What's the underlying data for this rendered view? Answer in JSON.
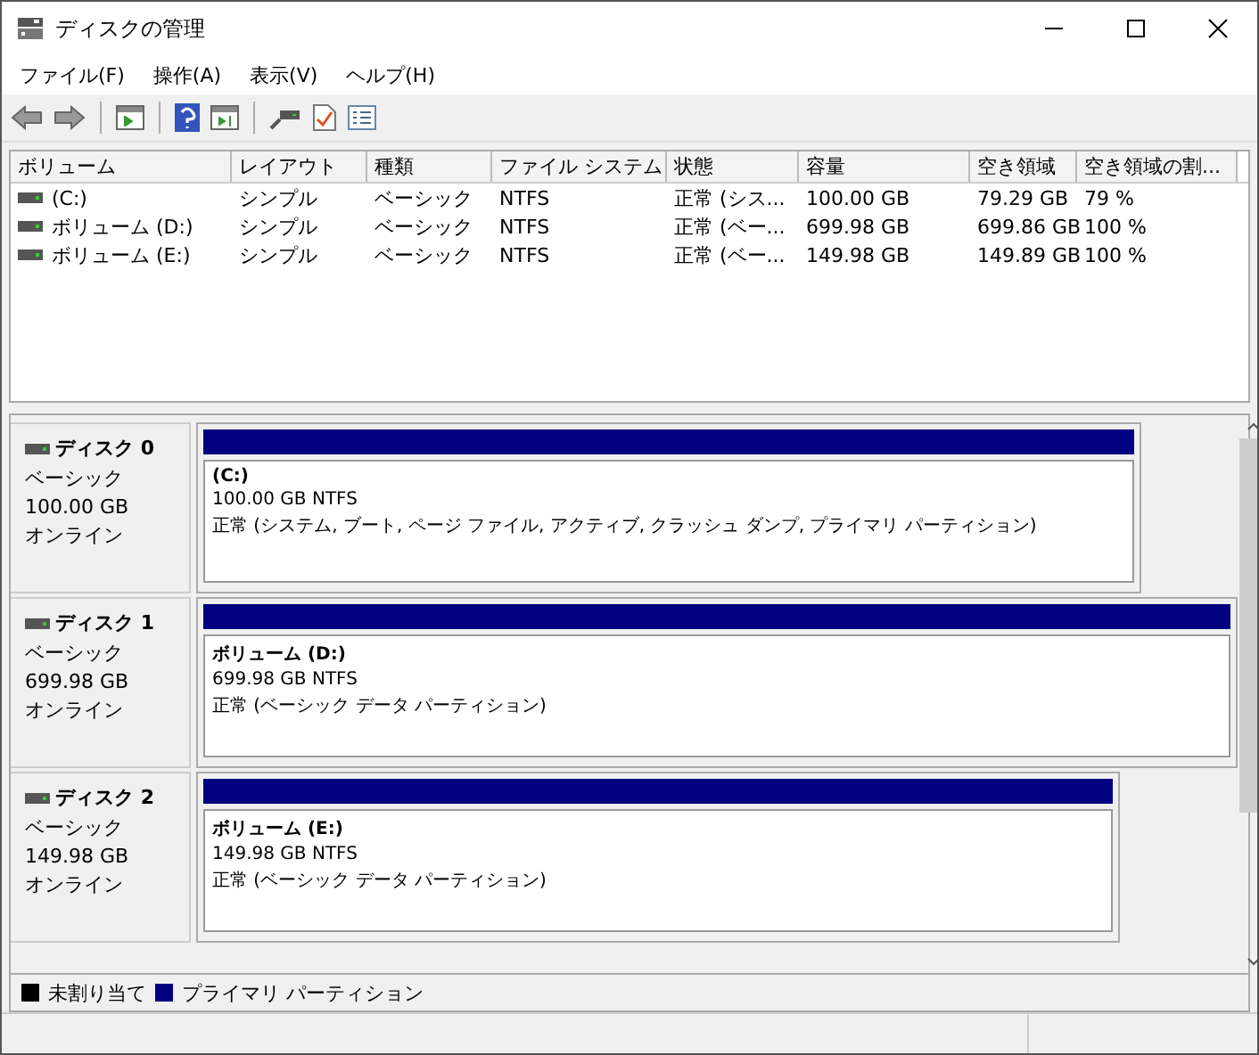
{
  "window": {
    "title": "ディスクの管理"
  },
  "menu": [
    "ファイル(F)",
    "操作(A)",
    "表示(V)",
    "ヘルプ(H)"
  ],
  "table": {
    "columns": [
      "ボリューム",
      "レイアウト",
      "種類",
      "ファイル システム",
      "状態",
      "容量",
      "空き領域",
      "空き領域の割..."
    ],
    "rows": [
      [
        "(C:)",
        "シンプル",
        "ベーシック",
        "NTFS",
        "正常 (シス...",
        "100.00 GB",
        "79.29 GB",
        "79 %"
      ],
      [
        "ボリューム (D:)",
        "シンプル",
        "ベーシック",
        "NTFS",
        "正常 (ベー...",
        "699.98 GB",
        "699.86 GB",
        "100 %"
      ],
      [
        "ボリューム (E:)",
        "シンプル",
        "ベーシック",
        "NTFS",
        "正常 (ベー...",
        "149.98 GB",
        "149.89 GB",
        "100 %"
      ]
    ]
  },
  "disks": [
    {
      "name": "ディスク 0",
      "type": "ベーシック",
      "size": "100.00 GB",
      "status": "オンライン",
      "partition": {
        "label": "(C:)",
        "info": "100.00 GB NTFS",
        "status": "正常 (システム, ブート, ページ ファイル, アクティブ, クラッシュ ダンプ, プライマリ パーティション)"
      }
    },
    {
      "name": "ディスク 1",
      "type": "ベーシック",
      "size": "699.98 GB",
      "status": "オンライン",
      "partition": {
        "label": "ボリューム  (D:)",
        "info": "699.98 GB NTFS",
        "status": "正常 (ベーシック データ パーティション)"
      }
    },
    {
      "name": "ディスク 2",
      "type": "ベーシック",
      "size": "149.98 GB",
      "status": "オンライン",
      "partition": {
        "label": "ボリューム  (E:)",
        "info": "149.98 GB NTFS",
        "status": "正常 (ベーシック データ パーティション)"
      }
    }
  ],
  "legend": [
    {
      "label": "未割り当て",
      "color": "#000000"
    },
    {
      "label": "プライマリ パーティション",
      "color": "#000080"
    }
  ]
}
